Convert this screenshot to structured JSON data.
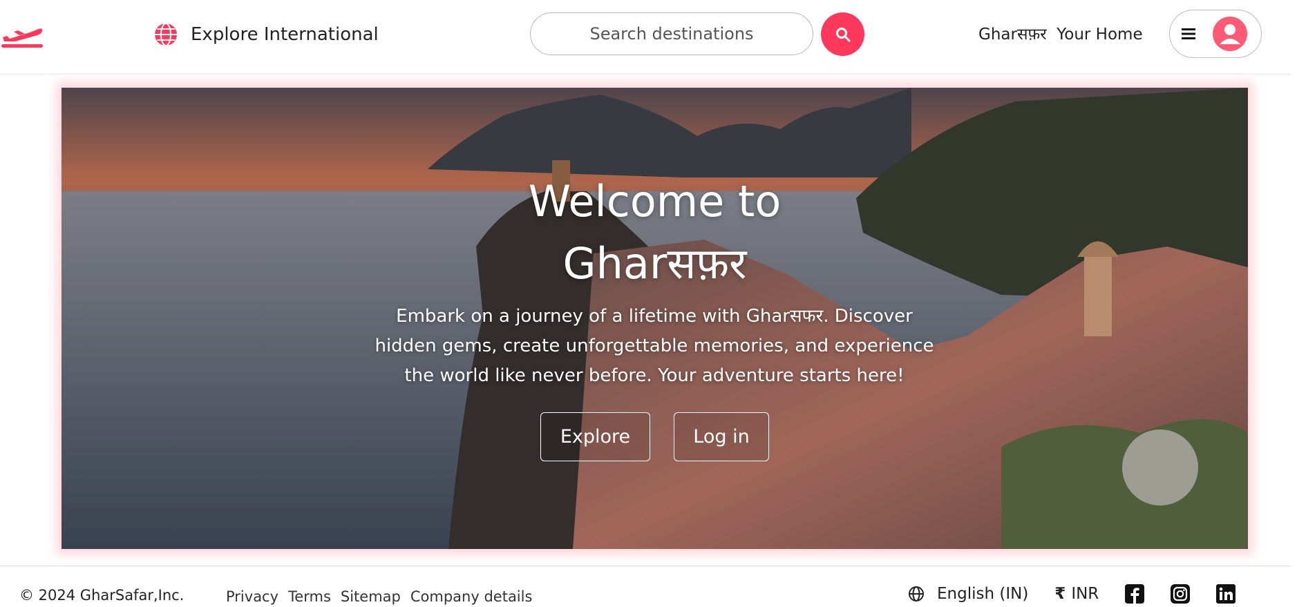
{
  "header": {
    "explore_label": "Explore International",
    "search_placeholder": "Search destinations",
    "your_home_label": "Gharसफ़र  Your Home"
  },
  "hero": {
    "title_line1": "Welcome to",
    "title_line2": "Gharसफ़र",
    "description": "Embark on a journey of a lifetime with Gharसफर. Discover hidden gems, create unforgettable memories, and experience the world like never before. Your adventure starts here!",
    "explore_button": "Explore",
    "login_button": "Log in"
  },
  "footer": {
    "copyright": "© 2024 GharSafar,Inc.",
    "links": [
      "Privacy",
      "Terms",
      "Sitemap",
      "Company details"
    ],
    "language": "English (IN)",
    "currency_symbol": "₹",
    "currency": "INR"
  },
  "colors": {
    "brand": "#ff385c",
    "text": "#222222"
  },
  "icons": [
    "plane-logo-icon",
    "globe-icon",
    "search-icon",
    "menu-icon",
    "user-icon",
    "rupee-icon",
    "facebook-icon",
    "instagram-icon",
    "linkedin-icon"
  ]
}
